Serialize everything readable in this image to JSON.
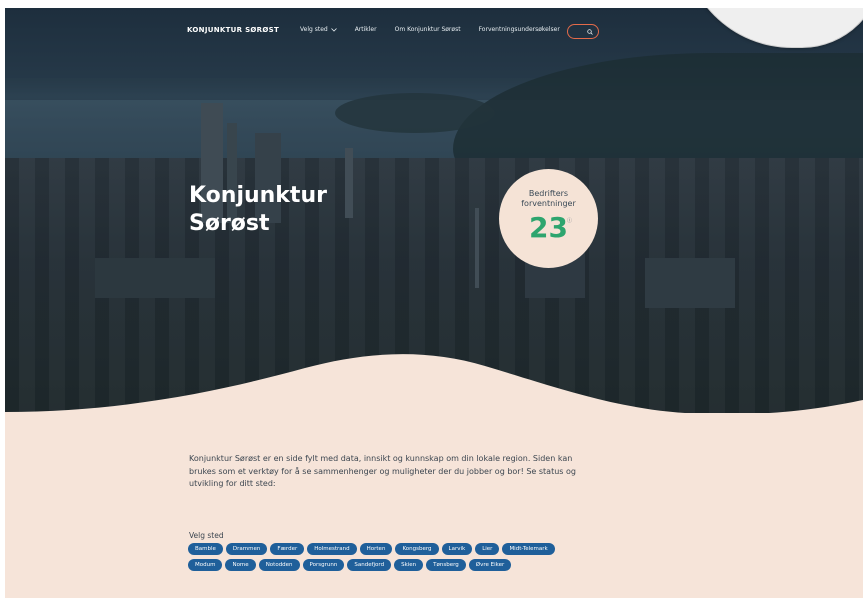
{
  "header": {
    "logo": "KONJUNKTUR SØRØST",
    "nav": [
      {
        "label": "Velg sted",
        "dropdown": true
      },
      {
        "label": "Artikler",
        "dropdown": false
      },
      {
        "label": "Om Konjunktur Sørøst",
        "dropdown": false
      },
      {
        "label": "Forventningsundersøkelser",
        "dropdown": false
      }
    ],
    "search_accent": "#e46b4a"
  },
  "hero": {
    "title_line1": "Konjunktur",
    "title_line2": "Sørøst"
  },
  "badge": {
    "label_line1": "Bedrifters",
    "label_line2": "forventninger",
    "value": "23",
    "superscript": "Ⓘ",
    "value_color": "#2da56e"
  },
  "intro": {
    "text": "Konjunktur Sørøst er en side fylt med data, innsikt og kunnskap om din lokale region. Siden kan brukes som et verktøy for å se sammenhenger og muligheter der du jobber og bor! Se status og utvikling for ditt sted:"
  },
  "places": {
    "label": "Velg sted",
    "items": [
      "Bamble",
      "Drammen",
      "Færder",
      "Holmestrand",
      "Horten",
      "Kongsberg",
      "Larvik",
      "Lier",
      "Midt-Telemark",
      "Modum",
      "Nome",
      "Notodden",
      "Porsgrunn",
      "Sandefjord",
      "Skien",
      "Tønsberg",
      "Øvre Eiker"
    ],
    "chip_color": "#1f5f9a"
  }
}
